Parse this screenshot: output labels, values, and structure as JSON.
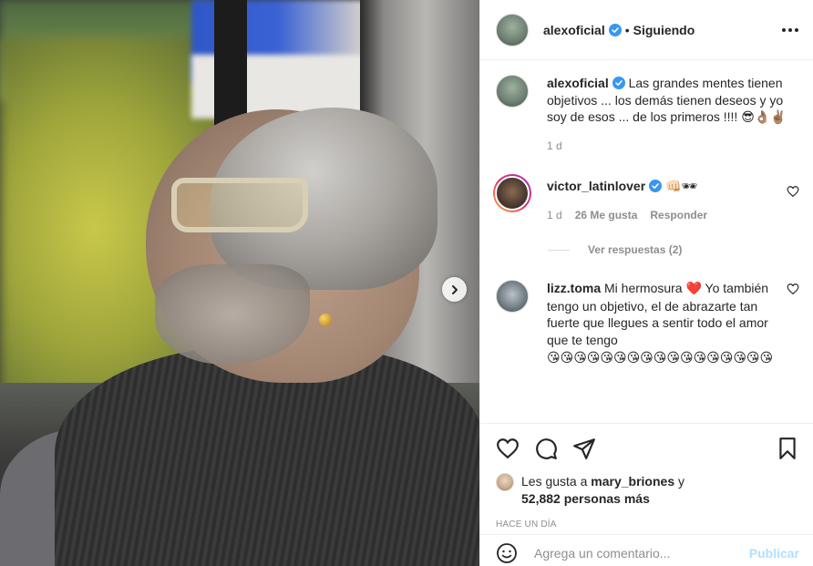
{
  "header": {
    "username": "alexoficial",
    "separator": "•",
    "follow_status": "Siguiendo"
  },
  "caption": {
    "username": "alexoficial",
    "text": "Las grandes mentes tienen objetivos ... los demás tienen deseos y yo soy de esos ... de los primeros !!!! ",
    "emojis": "😎👌🏽✌🏽",
    "time": "1 d"
  },
  "comments": [
    {
      "username": "victor_latinlover",
      "emojis": "👊🏻🕶",
      "time": "1 d",
      "likes": "26 Me gusta",
      "reply_label": "Responder",
      "view_replies": "Ver respuestas (2)"
    },
    {
      "username": "lizz.toma",
      "text_before": "Mi hermosura ",
      "heart": "❤️",
      "text_after": " Yo también tengo un objetivo, el de abrazarte tan fuerte que llegues a sentir todo el amor que te tengo",
      "emojis": "😘😘😘😘😘😘😘😘😘😘😘😘😘😘😘😘😘"
    }
  ],
  "likes": {
    "prefix": "Les gusta a ",
    "user": "mary_briones",
    "connector": " y",
    "count": "52,882 personas más"
  },
  "timestamp": "HACE UN DÍA",
  "add_comment": {
    "placeholder": "Agrega un comentario...",
    "publish_label": "Publicar"
  },
  "icons": {
    "heart": "heart-icon",
    "comment": "comment-icon",
    "share": "paper-plane-icon",
    "save": "bookmark-icon",
    "emoji": "smiley-icon",
    "next": "chevron-right-icon",
    "more": "more-options-icon",
    "verified": "verified-badge-icon"
  },
  "colors": {
    "verified": "#3897f0",
    "publish_disabled": "#b2dffc",
    "secondary_text": "#8e8e8e"
  }
}
